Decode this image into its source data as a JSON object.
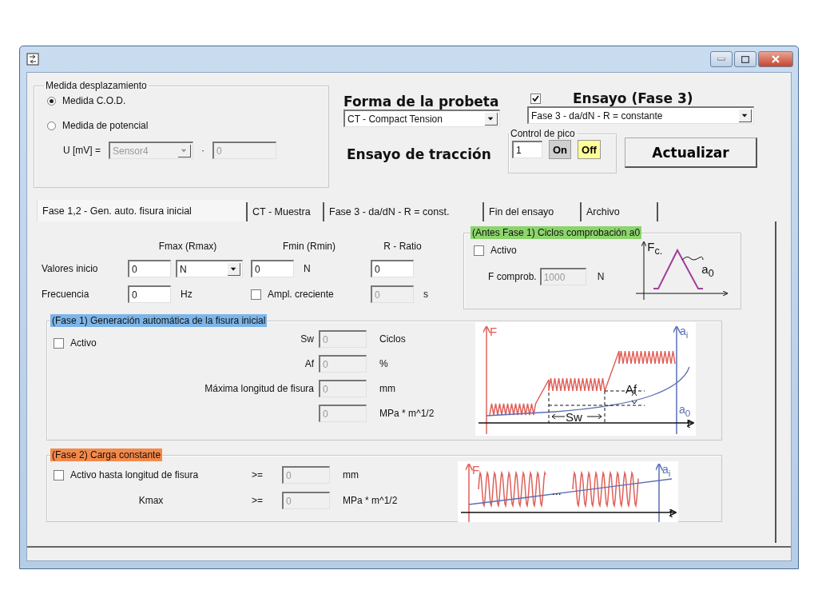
{
  "displacement": {
    "title": "Medida desplazamiento",
    "options": [
      {
        "label": "Medida C.O.D.",
        "selected": true
      },
      {
        "label": "Medida de potencial",
        "selected": false
      }
    ],
    "u_label": "U [mV] =",
    "sensor": {
      "value": "Sensor4",
      "disabled": true
    },
    "times": "·",
    "factor": {
      "value": "0",
      "disabled": true
    }
  },
  "specimen": {
    "title": "Forma de la probeta",
    "value": "CT - Compact Tension"
  },
  "tensile_title": "Ensayo de tracción",
  "test": {
    "checked": true,
    "title": "Ensayo (Fase 3)",
    "value": "Fase 3 - da/dN - R = constante"
  },
  "peak_control": {
    "title": "Control de pico",
    "value": "1",
    "buttons": [
      {
        "label": "On",
        "selected": false
      },
      {
        "label": "Off",
        "selected": true
      }
    ]
  },
  "update_button": "Actualizar",
  "tabs": [
    {
      "label": "Fase 1,2 - Gen. auto. fisura inicial",
      "selected": true
    },
    {
      "label": "CT - Muestra",
      "selected": false
    },
    {
      "label": "Fase 3 - da/dN - R = const.",
      "selected": false
    },
    {
      "label": "Fin del ensayo",
      "selected": false
    },
    {
      "label": "Archivo",
      "selected": false
    }
  ],
  "start_values": {
    "headers": [
      "Fmax (Rmax)",
      "Fmin (Rmin)",
      "R - Ratio"
    ],
    "row_label": "Valores inicio",
    "fmax": {
      "value": "0",
      "disabled": false
    },
    "fmax_unit": "N",
    "fmin": {
      "value": "0",
      "disabled": false
    },
    "fmin_unit": "N",
    "ratio": {
      "value": "0",
      "disabled": false
    },
    "freq_label": "Frecuencia",
    "freq": {
      "value": "0",
      "disabled": false
    },
    "freq_unit": "Hz",
    "ampl": {
      "label": "Ampl. creciente",
      "checked": false
    },
    "ampl_value": {
      "value": "0",
      "disabled": true
    },
    "ampl_unit": "s"
  },
  "check_cycles": {
    "title": "(Antes Fase 1) Ciclos comprobación a0",
    "color": "#8cd46c",
    "active": {
      "label": "Activo",
      "checked": false
    },
    "f_label": "F comprob.",
    "f_value": {
      "value": "1000",
      "disabled": true
    },
    "f_unit": "N",
    "diagram_labels": [
      "F$_{c.}$",
      "a$_{0}$"
    ]
  },
  "phase1": {
    "title": "(Fase 1) Generación automática de la fisura inicial",
    "color": "#7db5e8",
    "active": {
      "label": "Activo",
      "checked": false
    },
    "fields": [
      {
        "label": "Sw",
        "value": "0",
        "disabled": true,
        "unit": "Ciclos"
      },
      {
        "label": "Af",
        "value": "0",
        "disabled": true,
        "unit": "%"
      },
      {
        "label": "Máxima longitud de fisura",
        "value": "0",
        "disabled": true,
        "unit": "mm"
      },
      {
        "value": "0",
        "disabled": true,
        "unit": "MPa * m^1/2"
      }
    ],
    "diagram_labels": [
      "F",
      "a$_{i}$",
      "Af",
      "a$_{0}$",
      "Sw",
      "t"
    ]
  },
  "phase2": {
    "title": "(Fase 2) Carga constante",
    "color": "#f4894a",
    "active": {
      "label": "Activo hasta longitud de fisura",
      "checked": false
    },
    "fields": [
      {
        "op": ">=",
        "value": "0",
        "disabled": true,
        "unit": "mm"
      },
      {
        "label": "Kmax",
        "op": ">=",
        "value": "0",
        "disabled": true,
        "unit": "MPa * m^1/2"
      }
    ],
    "diagram_labels": [
      "F",
      "a$_{i}$",
      "...",
      "t"
    ]
  }
}
